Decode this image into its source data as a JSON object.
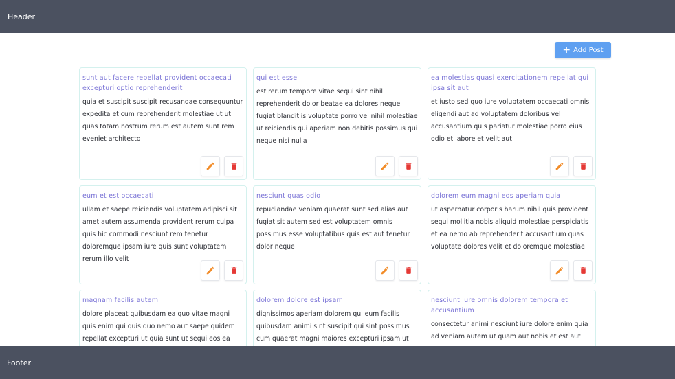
{
  "header": {
    "label": "Header"
  },
  "footer": {
    "label": "Footer"
  },
  "toolbar": {
    "add_label": "Add Post",
    "add_icon": "plus-icon",
    "add_color": "#5fa0f1"
  },
  "colors": {
    "edit": "#f28c28",
    "delete": "#e53935",
    "title": "#7a73d6",
    "bar": "#4b5160"
  },
  "posts": [
    {
      "title": "sunt aut facere repellat provident occaecati excepturi optio reprehenderit",
      "body": "quia et suscipit suscipit recusandae consequuntur expedita et cum reprehenderit molestiae ut ut quas totam nostrum rerum est autem sunt rem eveniet architecto"
    },
    {
      "title": "qui est esse",
      "body": "est rerum tempore vitae sequi sint nihil reprehenderit dolor beatae ea dolores neque fugiat blanditiis voluptate porro vel nihil molestiae ut reiciendis qui aperiam non debitis possimus qui neque nisi nulla"
    },
    {
      "title": "ea molestias quasi exercitationem repellat qui ipsa sit aut",
      "body": "et iusto sed quo iure voluptatem occaecati omnis eligendi aut ad voluptatem doloribus vel accusantium quis pariatur molestiae porro eius odio et labore et velit aut"
    },
    {
      "title": "eum et est occaecati",
      "body": "ullam et saepe reiciendis voluptatem adipisci sit amet autem assumenda provident rerum culpa quis hic commodi nesciunt rem tenetur doloremque ipsam iure quis sunt voluptatem rerum illo velit"
    },
    {
      "title": "nesciunt quas odio",
      "body": "repudiandae veniam quaerat sunt sed alias aut fugiat sit autem sed est voluptatem omnis possimus esse voluptatibus quis est aut tenetur dolor neque"
    },
    {
      "title": "dolorem eum magni eos aperiam quia",
      "body": "ut aspernatur corporis harum nihil quis provident sequi mollitia nobis aliquid molestiae perspiciatis et ea nemo ab reprehenderit accusantium quas voluptate dolores velit et doloremque molestiae"
    },
    {
      "title": "magnam facilis autem",
      "body": "dolore placeat quibusdam ea quo vitae magni quis enim qui quis quo nemo aut saepe quidem repellat excepturi ut quia sunt ut sequi eos ea sed quas"
    },
    {
      "title": "dolorem dolore est ipsam",
      "body": "dignissimos aperiam dolorem qui eum facilis quibusdam animi sint suscipit qui sint possimus cum quaerat magni maiores excepturi ipsam ut"
    },
    {
      "title": "nesciunt iure omnis dolorem tempora et accusantium",
      "body": "consectetur animi nesciunt iure dolore enim quia ad veniam autem ut quam aut nobis et est aut"
    }
  ]
}
